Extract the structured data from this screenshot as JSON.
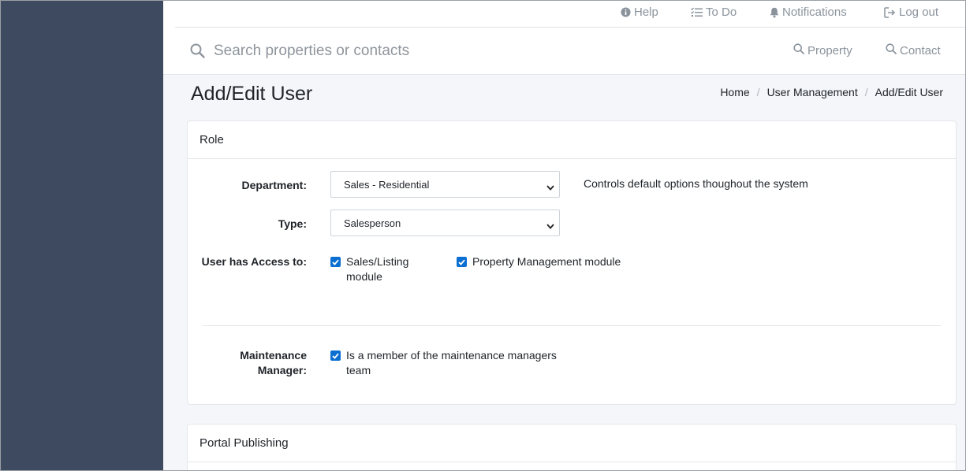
{
  "topbar": {
    "help": "Help",
    "todo": "To Do",
    "notifications": "Notifications",
    "logout": "Log out"
  },
  "search": {
    "placeholder": "Search properties or contacts",
    "property_label": "Property",
    "contact_label": "Contact"
  },
  "page": {
    "title": "Add/Edit User"
  },
  "breadcrumb": [
    "Home",
    "User Management",
    "Add/Edit User"
  ],
  "role_card": {
    "title": "Role",
    "department_label": "Department:",
    "department_value": "Sales - Residential",
    "department_help": "Controls default options thoughout the system",
    "type_label": "Type:",
    "type_value": "Salesperson",
    "access_label": "User has Access to:",
    "access_sales_line1": "Sales/Listing",
    "access_sales_line2": "module",
    "access_sales_checked": true,
    "access_pm": "Property Management module",
    "access_pm_checked": true,
    "maint_label_line1": "Maintenance",
    "maint_label_line2": "Manager:",
    "maint_line1": "Is a member of the maintenance managers",
    "maint_line2": "team",
    "maint_checked": true
  },
  "portal_card": {
    "title": "Portal Publishing"
  },
  "colors": {
    "sidebar": "#3d4a5f",
    "checkbox": "#0b6fd1",
    "muted_link": "#8a939c"
  }
}
